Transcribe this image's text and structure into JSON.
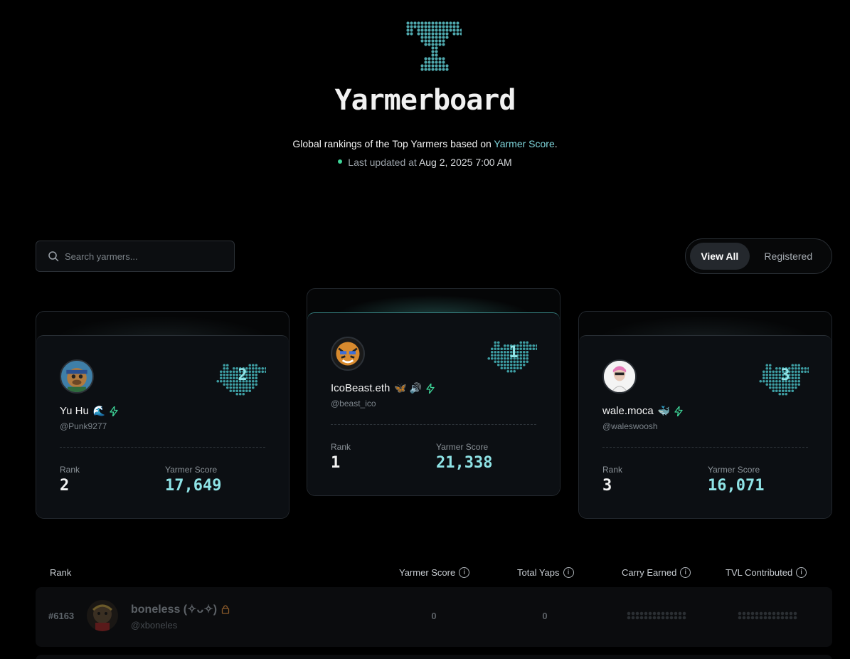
{
  "hero": {
    "title": "Yarmerboard",
    "subtitle_prefix": "Global rankings of the Top Yarmers based on ",
    "subtitle_link": "Yarmer Score",
    "subtitle_suffix": ".",
    "updated_label": "Last updated at",
    "updated_date": "Aug 2, 2025 7:00 AM"
  },
  "search": {
    "placeholder": "Search yarmers..."
  },
  "filter": {
    "view_all": "View All",
    "registered": "Registered",
    "selected": "View All"
  },
  "podium": {
    "rank_label": "Rank",
    "score_label": "Yarmer Score",
    "first": {
      "name": "IcoBeast.eth",
      "badges": "🦋 🔊",
      "handle": "@beast_ico",
      "rank": "1",
      "score": "21,338",
      "bird_number": "1"
    },
    "second": {
      "name": "Yu Hu",
      "badges": "🌊",
      "handle": "@Punk9277",
      "rank": "2",
      "score": "17,649",
      "bird_number": "2"
    },
    "third": {
      "name": "wale.moca",
      "badges": "🐳",
      "handle": "@waleswoosh",
      "rank": "3",
      "score": "16,071",
      "bird_number": "3"
    }
  },
  "table": {
    "headers": {
      "rank": "Rank",
      "score": "Yarmer Score",
      "yaps": "Total Yaps",
      "carry": "Carry Earned",
      "tvl": "TVL Contributed"
    },
    "rows": [
      {
        "rank": "#6163",
        "name": "boneless (✧ᴗ✧)",
        "handle": "@xboneles",
        "score": "0",
        "yaps": "0"
      }
    ]
  },
  "colors": {
    "accent": "#7fd6dc",
    "score": "#8fe3e6",
    "status_dot": "#3ed598",
    "lightning": "#3ed598"
  },
  "icons": [
    "trophy-icon",
    "search-icon",
    "bird-icon",
    "lightning-icon",
    "lock-icon",
    "info-icon"
  ]
}
